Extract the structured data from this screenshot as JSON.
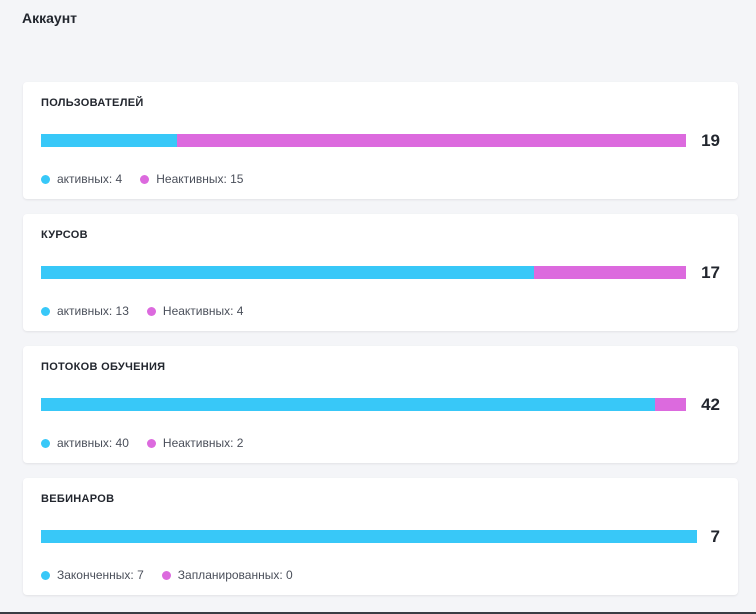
{
  "page": {
    "title": "Аккаунт"
  },
  "colors": {
    "active": "#38c8f8",
    "inactive": "#dc6ade"
  },
  "cards": [
    {
      "title": "ПОЛЬЗОВАТЕЛЕЙ",
      "total": "19",
      "segments": [
        4,
        15
      ],
      "legend": [
        {
          "label": "активных: 4"
        },
        {
          "label": "Неактивных: 15"
        }
      ]
    },
    {
      "title": "КУРСОВ",
      "total": "17",
      "segments": [
        13,
        4
      ],
      "legend": [
        {
          "label": "активных: 13"
        },
        {
          "label": "Неактивных: 4"
        }
      ]
    },
    {
      "title": "ПОТОКОВ ОБУЧЕНИЯ",
      "total": "42",
      "segments": [
        40,
        2
      ],
      "legend": [
        {
          "label": "активных: 40"
        },
        {
          "label": "Неактивных: 2"
        }
      ]
    },
    {
      "title": "ВЕБИНАРОВ",
      "total": "7",
      "segments": [
        7,
        0
      ],
      "legend": [
        {
          "label": "Законченных: 7"
        },
        {
          "label": "Запланированных: 0"
        }
      ]
    }
  ]
}
